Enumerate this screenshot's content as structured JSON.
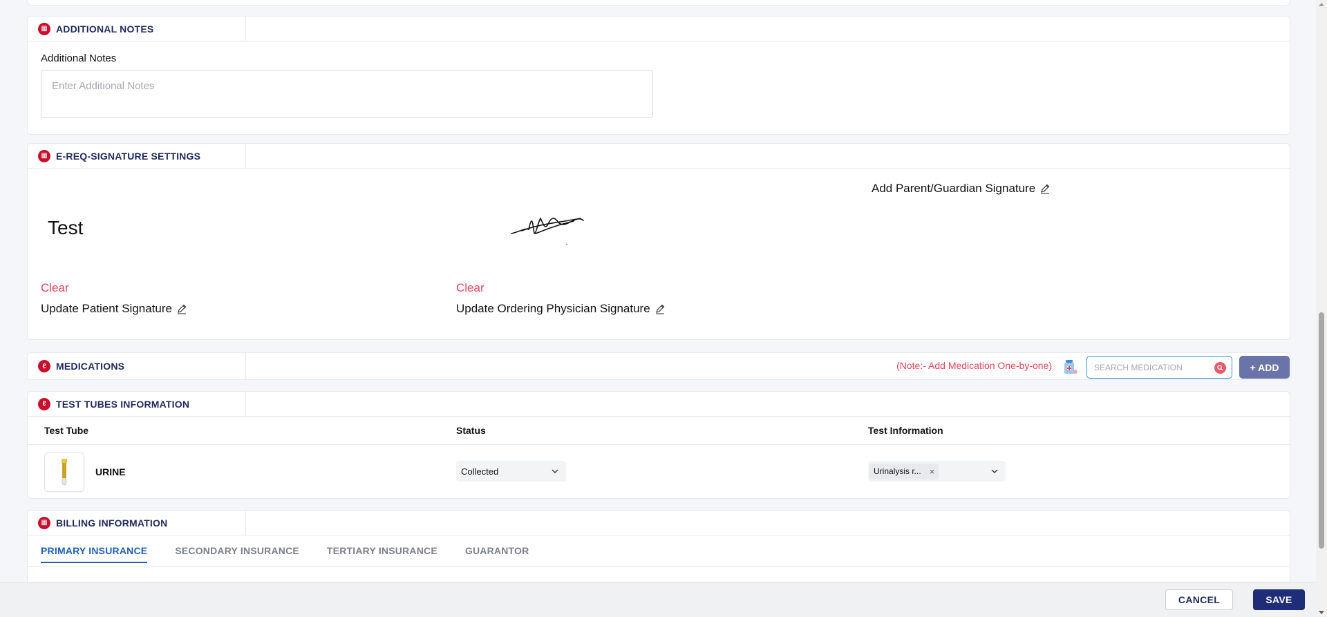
{
  "sections": {
    "additional_notes": {
      "title": "ADDITIONAL NOTES",
      "field_label": "Additional Notes",
      "placeholder": "Enter Additional Notes"
    },
    "signature": {
      "title": "E-REQ-SIGNATURE SETTINGS",
      "patient_signature_text": "Test",
      "patient_clear": "Clear",
      "patient_update": "Update Patient Signature",
      "physician_clear": "Clear",
      "physician_update": "Update Ordering Physician Signature",
      "guardian_add": "Add Parent/Guardian Signature"
    },
    "medications": {
      "title": "MEDICATIONS",
      "note": "(Note:- Add Medication One-by-one)",
      "search_placeholder": "SEARCH MEDICATION",
      "add_label": "+ ADD"
    },
    "test_tubes": {
      "title": "TEST TUBES INFORMATION",
      "columns": [
        "Test Tube",
        "Status",
        "Test Information"
      ],
      "rows": [
        {
          "tube": "URINE",
          "status": "Collected",
          "test_info_chip": "Urinalysis r..."
        }
      ]
    },
    "billing": {
      "title": "BILLING INFORMATION",
      "tabs": [
        "PRIMARY INSURANCE",
        "SECONDARY INSURANCE",
        "TERTIARY INSURANCE",
        "GUARANTOR"
      ],
      "active_tab": "PRIMARY INSURANCE"
    }
  },
  "footer": {
    "cancel_label": "CANCEL",
    "save_label": "SAVE"
  },
  "colors": {
    "section_icon": "#c8102e",
    "title": "#1f2a5c",
    "accent_red": "#e0455b",
    "active_tab": "#1e5fb4",
    "save_button": "#1f2d78",
    "add_button": "#6b74a8"
  }
}
